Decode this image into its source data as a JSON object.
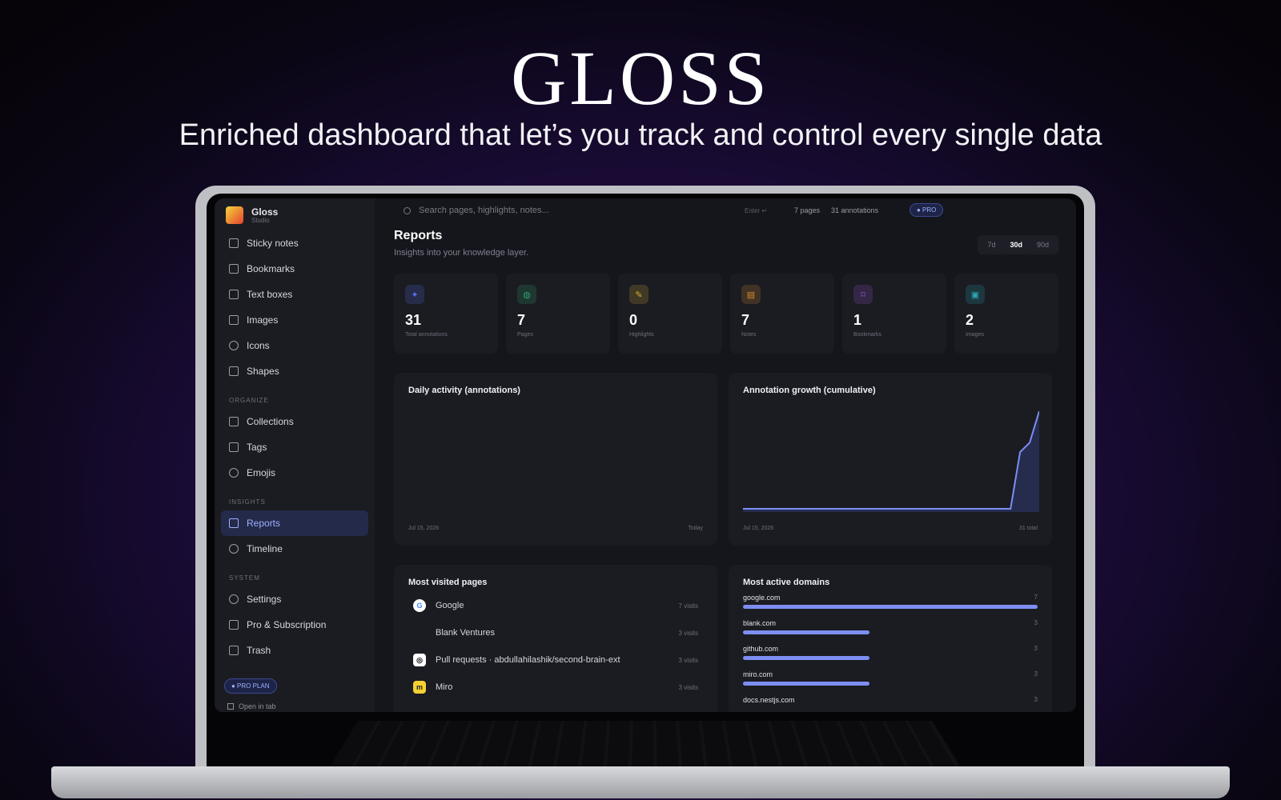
{
  "hero": {
    "title": "GLOSS",
    "subtitle": "Enriched dashboard that let’s you track and control every single data"
  },
  "app": {
    "name": "Gloss",
    "subname": "Studio",
    "colors": {
      "accent": "#7d8ef2",
      "active_bg": "#242a4a"
    }
  },
  "sidebar": {
    "items": [
      {
        "label": "Sticky notes",
        "icon": "sticky-note-icon"
      },
      {
        "label": "Bookmarks",
        "icon": "bookmark-icon"
      },
      {
        "label": "Text boxes",
        "icon": "text-icon"
      },
      {
        "label": "Images",
        "icon": "image-icon"
      },
      {
        "label": "Icons",
        "icon": "smiley-icon"
      },
      {
        "label": "Shapes",
        "icon": "shapes-icon"
      }
    ],
    "organize_header": "ORGANIZE",
    "organize": [
      {
        "label": "Collections",
        "icon": "folder-icon"
      },
      {
        "label": "Tags",
        "icon": "tag-icon"
      },
      {
        "label": "Emojis",
        "icon": "emoji-icon"
      }
    ],
    "insights_header": "INSIGHTS",
    "insights": [
      {
        "label": "Reports",
        "icon": "bar-chart-icon",
        "active": true
      },
      {
        "label": "Timeline",
        "icon": "history-icon"
      }
    ],
    "system_header": "SYSTEM",
    "system": [
      {
        "label": "Settings",
        "icon": "gear-icon"
      },
      {
        "label": "Pro & Subscription",
        "icon": "crown-icon"
      },
      {
        "label": "Trash",
        "icon": "trash-icon"
      }
    ],
    "plan_badge": "● PRO PLAN",
    "open_tab": "Open in tab"
  },
  "topbar": {
    "search_placeholder": "Search pages, highlights, notes...",
    "enter_hint": "Enter ↵",
    "pages": "7 pages",
    "annotations": "31 annotations",
    "pro": "● PRO"
  },
  "reports": {
    "title": "Reports",
    "subtitle": "Insights into your knowledge layer.",
    "ranges": [
      "7d",
      "30d",
      "90d"
    ],
    "selected_range": "30d"
  },
  "stats": [
    {
      "value": "31",
      "label": "Total annotations",
      "icon": "sparkle-icon",
      "color": "#5b6df0"
    },
    {
      "value": "7",
      "label": "Pages",
      "icon": "globe-icon",
      "color": "#2fa36b"
    },
    {
      "value": "0",
      "label": "Highlights",
      "icon": "highlighter-icon",
      "color": "#d5b032"
    },
    {
      "value": "7",
      "label": "Notes",
      "icon": "note-icon",
      "color": "#d88a2f"
    },
    {
      "value": "1",
      "label": "Bookmarks",
      "icon": "bookmark-icon",
      "color": "#9a55d8"
    },
    {
      "value": "2",
      "label": "Images",
      "icon": "image-icon",
      "color": "#2aa6b3"
    }
  ],
  "daily_activity": {
    "title": "Daily activity (annotations)",
    "x_start": "Jul 15, 2026",
    "x_end": "Today"
  },
  "chart_data": {
    "type": "area",
    "title": "Annotation growth (cumulative)",
    "x_start_label": "Jul 15, 2026",
    "x_end_label": "31 total",
    "values": [
      0,
      0,
      0,
      0,
      0,
      0,
      0,
      0,
      0,
      0,
      0,
      0,
      0,
      0,
      0,
      0,
      0,
      0,
      0,
      0,
      0,
      0,
      0,
      0,
      0,
      0,
      0,
      0,
      0,
      18,
      21,
      31
    ],
    "ylim": [
      0,
      31
    ],
    "grid": false
  },
  "most_visited": {
    "title": "Most visited pages",
    "rows": [
      {
        "name": "Google",
        "visits": "7 visits",
        "icon": "google-icon"
      },
      {
        "name": "Blank Ventures",
        "visits": "3 visits",
        "icon": "blank-icon"
      },
      {
        "name": "Pull requests · abdullahilashik/second-brain-ext",
        "visits": "3 visits",
        "icon": "github-icon"
      },
      {
        "name": "Miro",
        "visits": "3 visits",
        "icon": "miro-icon"
      }
    ]
  },
  "active_domains": {
    "title": "Most active domains",
    "rows": [
      {
        "domain": "google.com",
        "count": "7",
        "share": 1.0
      },
      {
        "domain": "blank.com",
        "count": "3",
        "share": 0.43
      },
      {
        "domain": "github.com",
        "count": "3",
        "share": 0.43
      },
      {
        "domain": "miro.com",
        "count": "3",
        "share": 0.43
      },
      {
        "domain": "docs.nestjs.com",
        "count": "3",
        "share": 0.43
      }
    ]
  }
}
